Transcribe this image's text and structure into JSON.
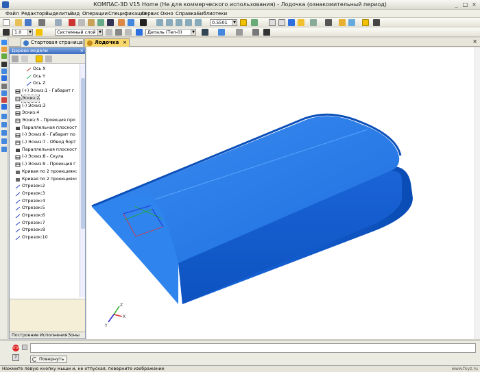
{
  "window": {
    "title": "КОМПАС-3D V15 Home (Не для коммерческого использования) - Лодочка (ознакомительный период)"
  },
  "menu": [
    "Файл",
    "Редактор",
    "Выделить",
    "Вид",
    "Операции",
    "Спецификация",
    "Сервис",
    "Окно",
    "Справка",
    "Библиотеки"
  ],
  "toolbar": {
    "scale_value": "1.0",
    "layer_value": "Системный слой (0)",
    "zoom_value": "0.5501",
    "part_value": "Деталь (Тел-0)"
  },
  "tabs": [
    {
      "label": "Стартовая страница",
      "active": false
    },
    {
      "label": "Лодочка",
      "active": true
    }
  ],
  "tree": {
    "title": "Дерево модели",
    "nodes": [
      {
        "text": "Ось X",
        "icon": "axis-x-icon",
        "color": "#c0392b",
        "indent": 2
      },
      {
        "text": "Ось Y",
        "icon": "axis-y-icon",
        "color": "#27ae60",
        "indent": 2
      },
      {
        "text": "Ось Z",
        "icon": "axis-z-icon",
        "color": "#2040c0",
        "indent": 2
      },
      {
        "text": "(+) Эскиз:1 - Габарит г",
        "icon": "sketch-icon",
        "color": "#333333",
        "indent": 1
      },
      {
        "text": "Эскиз:2",
        "icon": "sketch-icon",
        "color": "#333333",
        "indent": 1,
        "selected": true
      },
      {
        "text": "(-) Эскиз:3",
        "icon": "sketch-icon",
        "color": "#333333",
        "indent": 1
      },
      {
        "text": "Эскиз:4",
        "icon": "sketch-icon",
        "color": "#333333",
        "indent": 1
      },
      {
        "text": "Эскиз:5 - Проекция про",
        "icon": "sketch-icon",
        "color": "#333333",
        "indent": 1
      },
      {
        "text": "Параллельная плоскост",
        "icon": "plane-icon",
        "color": "#333333",
        "indent": 1
      },
      {
        "text": "(-) Эскиз:6 - Габарит по",
        "icon": "sketch-icon",
        "color": "#333333",
        "indent": 1
      },
      {
        "text": "(-) Эскиз:7 - Обвод борт",
        "icon": "sketch-icon",
        "color": "#333333",
        "indent": 1
      },
      {
        "text": "Параллельная плоскост",
        "icon": "plane-icon",
        "color": "#333333",
        "indent": 1
      },
      {
        "text": "(-) Эскиз:8 - Скула",
        "icon": "sketch-icon",
        "color": "#333333",
        "indent": 1
      },
      {
        "text": "(-) Эскиз:9 - Проекция г",
        "icon": "sketch-icon",
        "color": "#333333",
        "indent": 1
      },
      {
        "text": "Кривая по 2 проекциям:",
        "icon": "curve-icon",
        "color": "#333333",
        "indent": 1
      },
      {
        "text": "Кривая по 2 проекциям:",
        "icon": "curve-icon",
        "color": "#333333",
        "indent": 1
      },
      {
        "text": "Отрезок:2",
        "icon": "segment-icon",
        "color": "#2040c0",
        "indent": 1
      },
      {
        "text": "Отрезок:3",
        "icon": "segment-icon",
        "color": "#2040c0",
        "indent": 1
      },
      {
        "text": "Отрезок:4",
        "icon": "segment-icon",
        "color": "#2040c0",
        "indent": 1
      },
      {
        "text": "Отрезок:5",
        "icon": "segment-icon",
        "color": "#2040c0",
        "indent": 1
      },
      {
        "text": "Отрезок:6",
        "icon": "segment-icon",
        "color": "#2040c0",
        "indent": 1
      },
      {
        "text": "Отрезок:7",
        "icon": "segment-icon",
        "color": "#2040c0",
        "indent": 1
      },
      {
        "text": "Отрезок:8",
        "icon": "segment-icon",
        "color": "#2040c0",
        "indent": 1
      },
      {
        "text": "Отрезок:10",
        "icon": "segment-icon",
        "color": "#2040c0",
        "indent": 1
      }
    ],
    "bottom_tabs": [
      "Построение",
      "Исполнения",
      "Зоны"
    ]
  },
  "viewport": {
    "model_color": "#1f6fe0",
    "model_dark": "#0b4fb8",
    "model_light": "#3b8cf0",
    "axis_labels": [
      "Z",
      "X",
      "Y"
    ]
  },
  "command_panel": {
    "stop_label": "STOP",
    "rotate_label": "Повернуть"
  },
  "status": {
    "text": "Нажмите левую кнопку мыши и, не отпуская, поверните изображение",
    "watermark": "www.fxyz.ru"
  }
}
